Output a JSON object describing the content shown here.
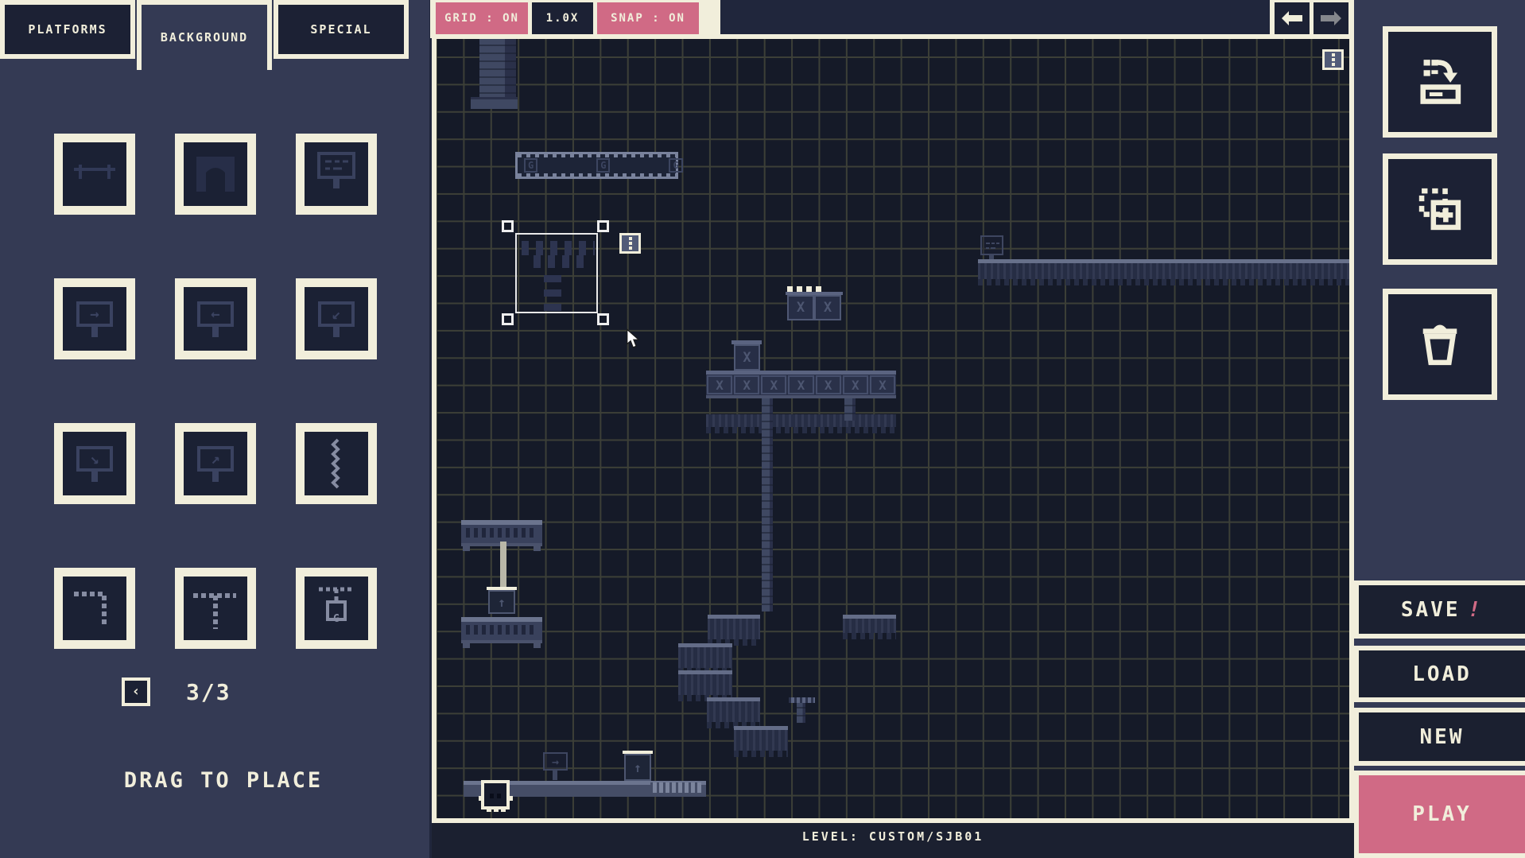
{
  "tabs": {
    "platforms": "PLATFORMS",
    "background": "BACKGROUND",
    "special": "SPECIAL"
  },
  "toolbar": {
    "grid_toggle": "GRID : ON",
    "zoom_level": "1.0X",
    "snap_toggle": "SNAP : ON"
  },
  "palette": {
    "page_indicator": "3/3",
    "prev_icon": "‹",
    "hint": "DRAG TO PLACE",
    "tiles": [
      "bench",
      "archway",
      "sign-text",
      "sign-arrow-right",
      "sign-arrow-left",
      "sign-arrow-down-left",
      "sign-arrow-down-right",
      "sign-arrow-up-right",
      "chain-vertical",
      "chain-corner",
      "chain-t",
      "chain-lantern"
    ]
  },
  "icons": {
    "arrow_right": "→",
    "arrow_left": "←",
    "arrow_down_left": "↙",
    "arrow_down_right": "↘",
    "arrow_up_right": "↗",
    "arrow_up": "↑",
    "x": "X",
    "g": "G"
  },
  "file_buttons": {
    "save": "SAVE",
    "save_alert": "!",
    "load": "LOAD",
    "new": "NEW",
    "play": "PLAY"
  },
  "status": {
    "level": "LEVEL: CUSTOM/SJB01"
  },
  "colors": {
    "accent_pink": "#d06a85",
    "cream": "#f1eedb",
    "panel_bg": "#343a54",
    "dark_navy": "#1c2134",
    "canvas_bg": "#151a28",
    "grid_line": "#3c3f37"
  }
}
